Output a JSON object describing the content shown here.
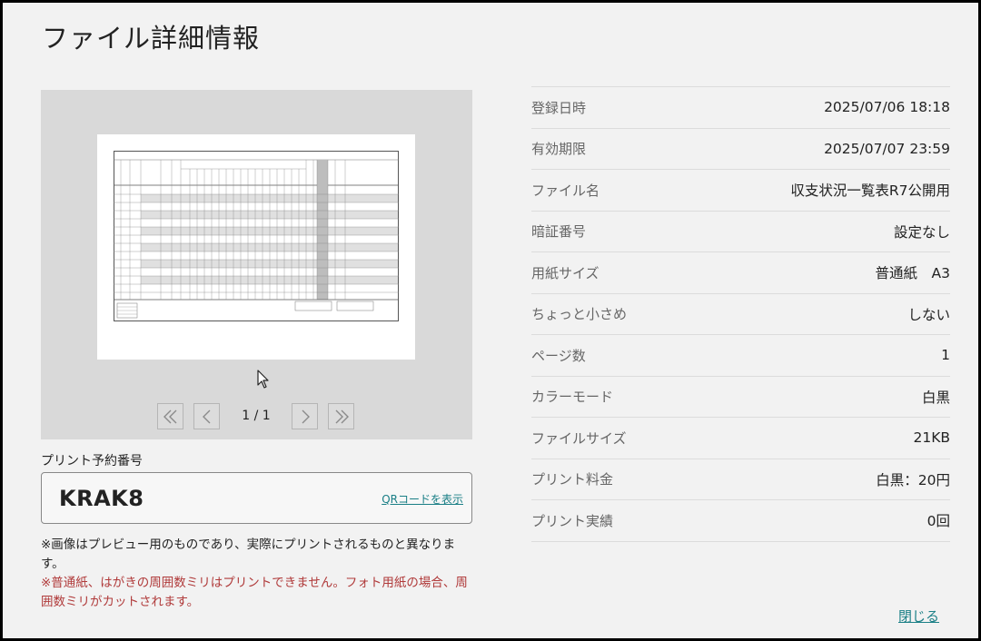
{
  "page": {
    "title": "ファイル詳細情報"
  },
  "preview": {
    "page_counter": "1 / 1",
    "note": "※画像はプレビュー用のものであり、実際にプリントされるものと異なります。",
    "warning": "※普通紙、はがきの周囲数ミリはプリントできません。フォト用紙の場合、周囲数ミリがカットされます。",
    "pager_icons": [
      "first-page-icon",
      "prev-page-icon",
      "next-page-icon",
      "last-page-icon"
    ]
  },
  "reservation": {
    "label": "プリント予約番号",
    "number": "KRAK8",
    "qr_link": "QRコードを表示"
  },
  "details": [
    {
      "label": "登録日時",
      "value": "2025/07/06 18:18"
    },
    {
      "label": "有効期限",
      "value": "2025/07/07 23:59"
    },
    {
      "label": "ファイル名",
      "value": "収支状況一覧表R7公開用"
    },
    {
      "label": "暗証番号",
      "value": "設定なし"
    },
    {
      "label": "用紙サイズ",
      "value": "普通紙　A3"
    },
    {
      "label": "ちょっと小さめ",
      "value": "しない"
    },
    {
      "label": "ページ数",
      "value": "1"
    },
    {
      "label": "カラーモード",
      "value": "白黒"
    },
    {
      "label": "ファイルサイズ",
      "value": "21KB"
    },
    {
      "label": "プリント料金",
      "value": "白黒：20円"
    },
    {
      "label": "プリント実績",
      "value": "0回"
    }
  ],
  "footer": {
    "close_label": "閉じる"
  },
  "colors": {
    "link": "#1a7f86",
    "warning": "#b03a3a",
    "preview_bg": "#d9d9d9"
  }
}
